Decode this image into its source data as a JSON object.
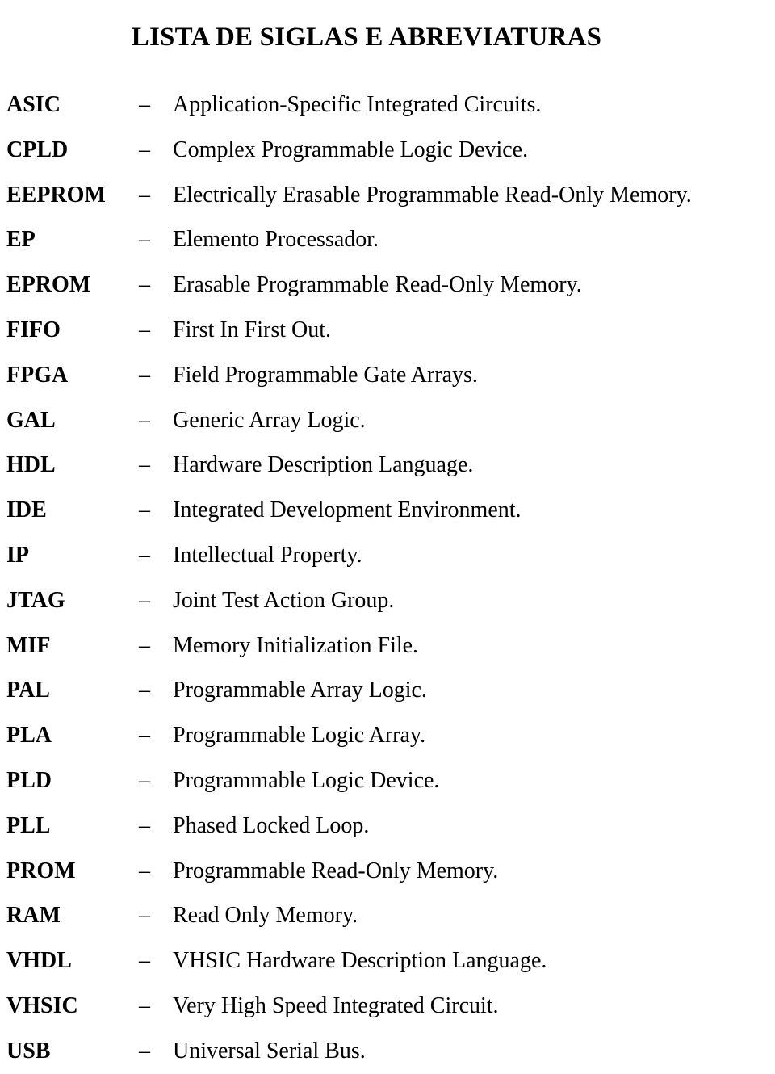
{
  "document": {
    "title": "LISTA DE SIGLAS E ABREVIATURAS",
    "separator": "–",
    "entries": [
      {
        "term": "ASIC",
        "definition": "Application-Specific Integrated Circuits."
      },
      {
        "term": "CPLD",
        "definition": "Complex Programmable Logic Device."
      },
      {
        "term": "EEPROM",
        "definition": "Electrically Erasable Programmable Read-Only Memory."
      },
      {
        "term": "EP",
        "definition": "Elemento Processador."
      },
      {
        "term": "EPROM",
        "definition": "Erasable Programmable Read-Only Memory."
      },
      {
        "term": "FIFO",
        "definition": "First In First Out."
      },
      {
        "term": "FPGA",
        "definition": "Field Programmable Gate Arrays."
      },
      {
        "term": "GAL",
        "definition": "Generic Array Logic."
      },
      {
        "term": "HDL",
        "definition": "Hardware Description Language."
      },
      {
        "term": "IDE",
        "definition": "Integrated Development Environment."
      },
      {
        "term": "IP",
        "definition": "Intellectual Property."
      },
      {
        "term": "JTAG",
        "definition": "Joint Test Action Group."
      },
      {
        "term": "MIF",
        "definition": "Memory Initialization File."
      },
      {
        "term": "PAL",
        "definition": "Programmable Array Logic."
      },
      {
        "term": "PLA",
        "definition": "Programmable Logic Array."
      },
      {
        "term": "PLD",
        "definition": "Programmable Logic Device."
      },
      {
        "term": "PLL",
        "definition": "Phased Locked Loop."
      },
      {
        "term": "PROM",
        "definition": "Programmable Read-Only Memory."
      },
      {
        "term": "RAM",
        "definition": "Read Only Memory."
      },
      {
        "term": "VHDL",
        "definition": "VHSIC Hardware Description Language."
      },
      {
        "term": "VHSIC",
        "definition": "Very High Speed Integrated Circuit."
      },
      {
        "term": "USB",
        "definition": "Universal Serial Bus."
      }
    ]
  }
}
